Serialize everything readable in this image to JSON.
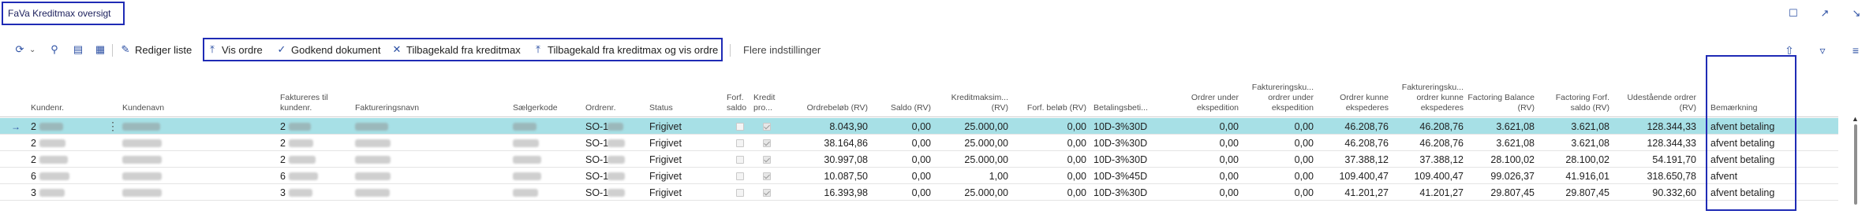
{
  "window": {
    "title": "FaVa Kreditmax oversigt",
    "top_icons": [
      "bookmark-icon",
      "open-in-new-icon",
      "collapse-icon"
    ]
  },
  "actions": {
    "edit_list": "Rediger liste",
    "show_order": "Vis ordre",
    "approve_document": "Godkend dokument",
    "recall_credit": "Tilbagekald fra kreditmax",
    "recall_credit_show": "Tilbagekald fra kreditmax og vis ordre",
    "more_settings": "Flere indstillinger"
  },
  "columns": {
    "customer_no": "Kundenr.",
    "customer_name": "Kundenavn",
    "invoice_to": "Faktureres til kundenr.",
    "invoice_name": "Faktureringsnavn",
    "salesperson": "Sælgerkode",
    "order_no": "Ordrenr.",
    "status": "Status",
    "due_balance": "Forf. saldo",
    "credit_pro": "Kredit pro...",
    "order_amount": "Ordrebeløb (RV)",
    "balance": "Saldo (RV)",
    "credit_max": "Kreditmaksim... (RV)",
    "due_amount": "Forf. beløb (RV)",
    "payment_terms": "Betalingsbeti...",
    "orders_shipping": "Ordrer under ekspedition",
    "invoicing_orders_shipping": "Faktureringsku... ordrer under ekspedition",
    "orders_shippable": "Ordrer kunne ekspederes",
    "invoicing_orders_shippable": "Faktureringsku... ordrer kunne ekspederes",
    "factoring_balance": "Factoring Balance (RV)",
    "factoring_due": "Factoring Forf. saldo (RV)",
    "outstanding_orders": "Udestående ordrer (RV)",
    "remark": "Bemærkning"
  },
  "rows": [
    {
      "cust_prefix": "2",
      "inv_prefix": "2",
      "order_prefix": "SO-1",
      "status": "Frigivet",
      "order_amount": "8.043,90",
      "balance": "0,00",
      "credit_max": "25.000,00",
      "due_amount": "0,00",
      "terms": "10D-3%30D",
      "shipping": "0,00",
      "inv_shipping": "0,00",
      "shippable": "46.208,76",
      "inv_shippable": "46.208,76",
      "fact_balance": "3.621,08",
      "fact_due": "3.621,08",
      "outstanding": "128.344,33",
      "remark": "afvent betaling",
      "selected": true
    },
    {
      "cust_prefix": "2",
      "inv_prefix": "2",
      "order_prefix": "SO-1",
      "status": "Frigivet",
      "order_amount": "38.164,86",
      "balance": "0,00",
      "credit_max": "25.000,00",
      "due_amount": "0,00",
      "terms": "10D-3%30D",
      "shipping": "0,00",
      "inv_shipping": "0,00",
      "shippable": "46.208,76",
      "inv_shippable": "46.208,76",
      "fact_balance": "3.621,08",
      "fact_due": "3.621,08",
      "outstanding": "128.344,33",
      "remark": "afvent betaling",
      "selected": false
    },
    {
      "cust_prefix": "2",
      "inv_prefix": "2",
      "order_prefix": "SO-1",
      "status": "Frigivet",
      "order_amount": "30.997,08",
      "balance": "0,00",
      "credit_max": "25.000,00",
      "due_amount": "0,00",
      "terms": "10D-3%30D",
      "shipping": "0,00",
      "inv_shipping": "0,00",
      "shippable": "37.388,12",
      "inv_shippable": "37.388,12",
      "fact_balance": "28.100,02",
      "fact_due": "28.100,02",
      "outstanding": "54.191,70",
      "remark": "afvent betaling",
      "selected": false
    },
    {
      "cust_prefix": "6",
      "inv_prefix": "6",
      "order_prefix": "SO-1",
      "status": "Frigivet",
      "order_amount": "10.087,50",
      "balance": "0,00",
      "credit_max": "1,00",
      "due_amount": "0,00",
      "terms": "10D-3%45D",
      "shipping": "0,00",
      "inv_shipping": "0,00",
      "shippable": "109.400,47",
      "inv_shippable": "109.400,47",
      "fact_balance": "99.026,37",
      "fact_due": "41.916,01",
      "outstanding": "318.650,78",
      "remark": "afvent",
      "selected": false
    },
    {
      "cust_prefix": "3",
      "inv_prefix": "3",
      "order_prefix": "SO-1",
      "status": "Frigivet",
      "order_amount": "16.393,98",
      "balance": "0,00",
      "credit_max": "25.000,00",
      "due_amount": "0,00",
      "terms": "10D-3%30D",
      "shipping": "0,00",
      "inv_shipping": "0,00",
      "shippable": "41.201,27",
      "inv_shippable": "41.201,27",
      "fact_balance": "29.807,45",
      "fact_due": "29.807,45",
      "outstanding": "90.332,60",
      "remark": "afvent betaling",
      "selected": false
    }
  ],
  "colors": {
    "accent": "#2b4fa3",
    "highlight_border": "#1f2bb5",
    "selected_row": "#a7e0e6"
  }
}
